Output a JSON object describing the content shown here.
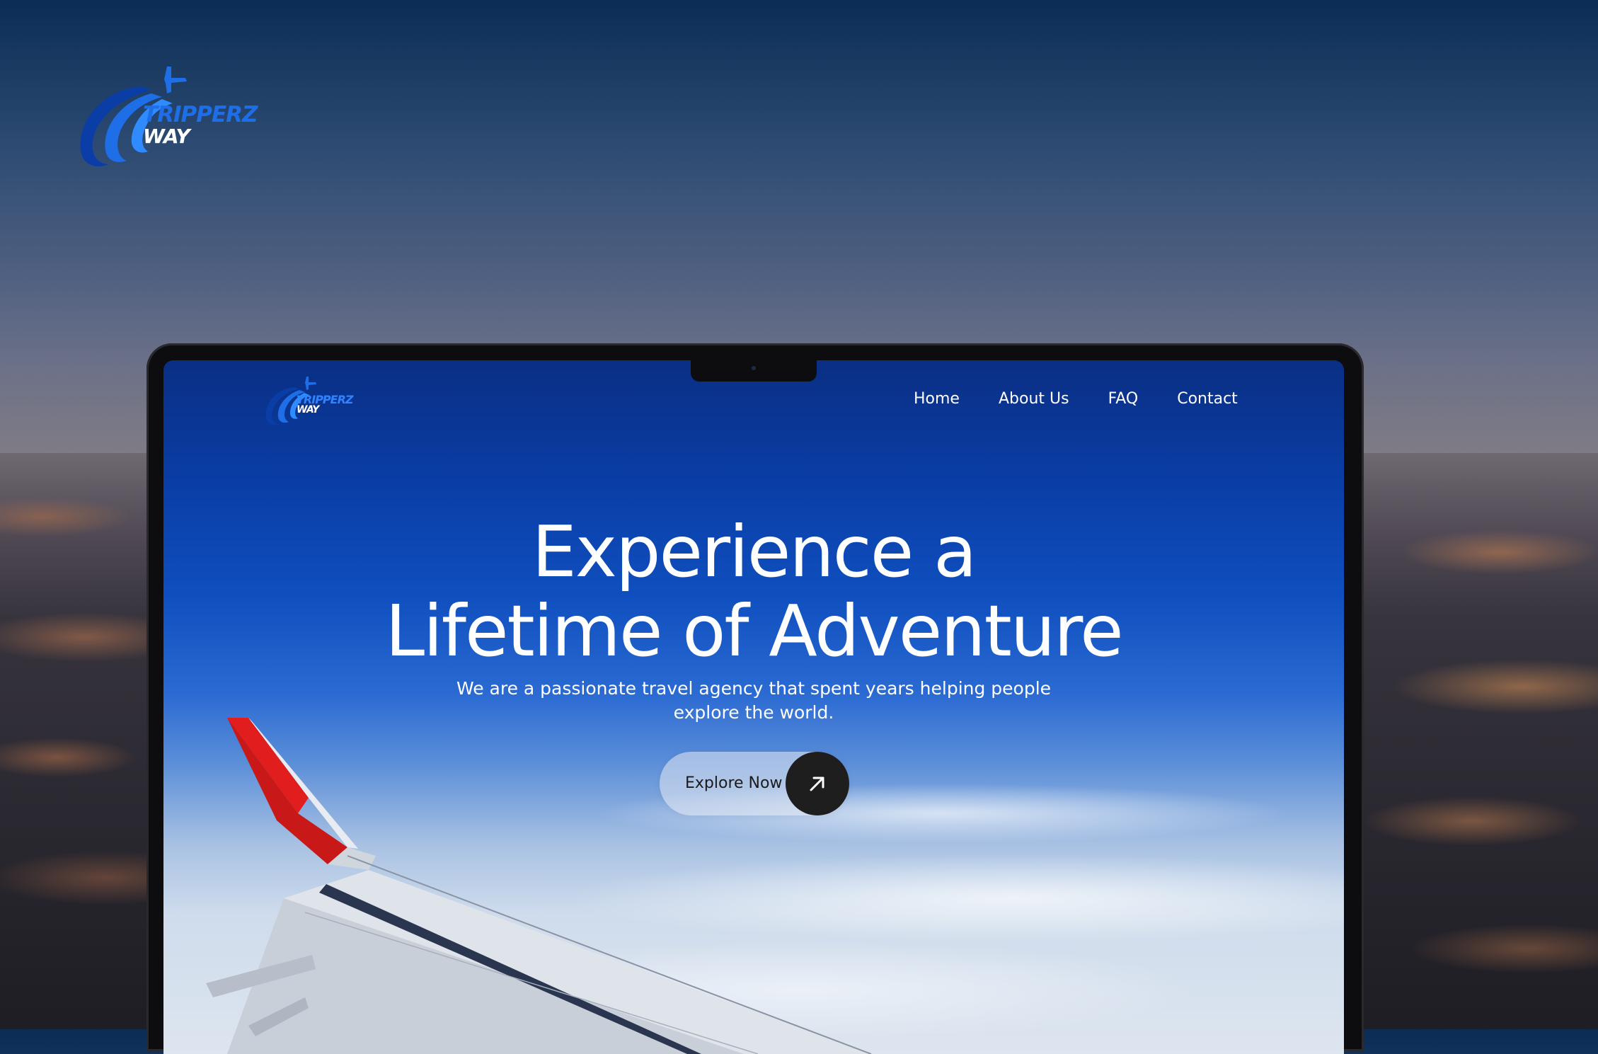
{
  "brand": {
    "name_line1": "TRIPPERZ",
    "name_line2": "WAY"
  },
  "nav": {
    "items": [
      {
        "label": "Home"
      },
      {
        "label": "About Us"
      },
      {
        "label": "FAQ"
      },
      {
        "label": "Contact"
      }
    ]
  },
  "hero": {
    "title_line1": "Experience a",
    "title_line2": "Lifetime of Adventure",
    "subtitle_line1": "We are a passionate travel agency that spent years helping people",
    "subtitle_line2": "explore the world.",
    "cta_label": "Explore Now",
    "cta_icon": "arrow-up-right-icon"
  },
  "colors": {
    "brand_blue": "#1e6ee8",
    "hero_blue": "#0a3ea6",
    "cta_dark": "#1e1e1e",
    "wing_red": "#e11d1d"
  }
}
